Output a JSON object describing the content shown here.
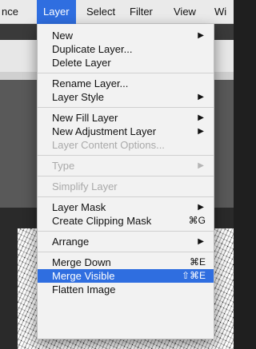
{
  "menubar": {
    "items": [
      {
        "label": "nce"
      },
      {
        "label": "Layer"
      },
      {
        "label": "Select"
      },
      {
        "label": "Filter"
      },
      {
        "label": "View"
      },
      {
        "label": "Wi"
      }
    ]
  },
  "menu": {
    "new": {
      "label": "New",
      "arrow": "▶"
    },
    "duplicate_layer": {
      "label": "Duplicate Layer..."
    },
    "delete_layer": {
      "label": "Delete Layer"
    },
    "rename_layer": {
      "label": "Rename Layer..."
    },
    "layer_style": {
      "label": "Layer Style",
      "arrow": "▶"
    },
    "new_fill_layer": {
      "label": "New Fill Layer",
      "arrow": "▶"
    },
    "new_adjustment_layer": {
      "label": "New Adjustment Layer",
      "arrow": "▶"
    },
    "layer_content_options": {
      "label": "Layer Content Options..."
    },
    "type": {
      "label": "Type",
      "arrow": "▶"
    },
    "simplify_layer": {
      "label": "Simplify Layer"
    },
    "layer_mask": {
      "label": "Layer Mask",
      "arrow": "▶"
    },
    "create_clipping_mask": {
      "label": "Create Clipping Mask",
      "shortcut": "⌘G"
    },
    "arrange": {
      "label": "Arrange",
      "arrow": "▶"
    },
    "merge_down": {
      "label": "Merge Down",
      "shortcut": "⌘E"
    },
    "merge_visible": {
      "label": "Merge Visible",
      "shortcut": "⇧⌘E"
    },
    "flatten_image": {
      "label": "Flatten Image"
    }
  },
  "colors": {
    "accent": "#2f6ee0",
    "menu_bg": "#f2f2f2",
    "disabled_text": "#a9a9a9"
  }
}
